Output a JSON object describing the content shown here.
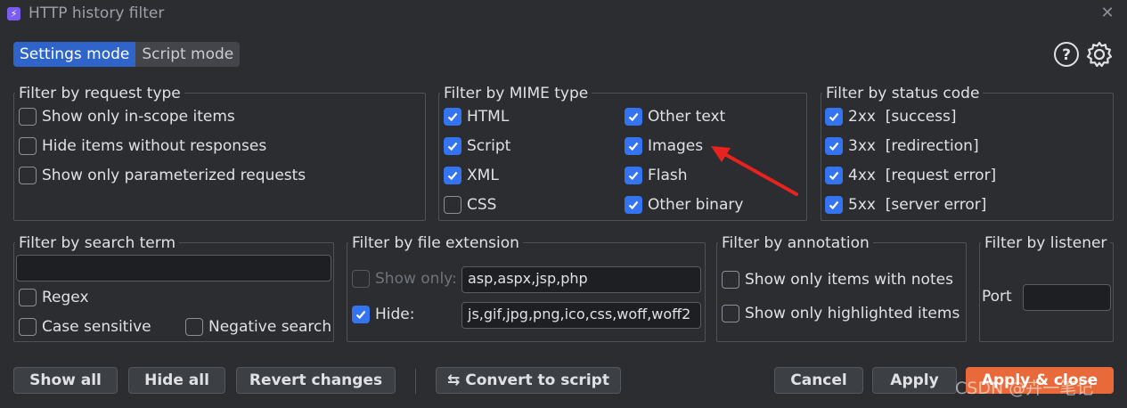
{
  "window": {
    "title": "HTTP history filter",
    "app_icon_glyph": "⚡"
  },
  "mode": {
    "settings_label": "Settings mode",
    "script_label": "Script mode",
    "active": "settings"
  },
  "request_type": {
    "legend": "Filter by request type",
    "items": [
      {
        "label": "Show only in-scope items",
        "checked": false
      },
      {
        "label": "Hide items without responses",
        "checked": false
      },
      {
        "label": "Show only parameterized requests",
        "checked": false
      }
    ]
  },
  "mime_type": {
    "legend": "Filter by MIME type",
    "items": [
      {
        "label": "HTML",
        "checked": true
      },
      {
        "label": "Other text",
        "checked": true
      },
      {
        "label": "Script",
        "checked": true
      },
      {
        "label": "Images",
        "checked": true
      },
      {
        "label": "XML",
        "checked": true
      },
      {
        "label": "Flash",
        "checked": true
      },
      {
        "label": "CSS",
        "checked": false
      },
      {
        "label": "Other binary",
        "checked": true
      }
    ]
  },
  "status_code": {
    "legend": "Filter by status code",
    "items": [
      {
        "label": "2xx  [success]",
        "checked": true
      },
      {
        "label": "3xx  [redirection]",
        "checked": true
      },
      {
        "label": "4xx  [request error]",
        "checked": true
      },
      {
        "label": "5xx  [server error]",
        "checked": true
      }
    ]
  },
  "search_term": {
    "legend": "Filter by search term",
    "value": "",
    "regex": "Regex",
    "case_sensitive": "Case sensitive",
    "negative": "Negative search"
  },
  "file_extension": {
    "legend": "Filter by file extension",
    "show_only_label": "Show only:",
    "show_only_value": "asp,aspx,jsp,php",
    "hide_label": "Hide:",
    "hide_value": "js,gif,jpg,png,ico,css,woff,woff2"
  },
  "annotation": {
    "legend": "Filter by annotation",
    "notes": "Show only items with notes",
    "highlighted": "Show only highlighted items"
  },
  "listener": {
    "legend": "Filter by listener",
    "port_label": "Port",
    "port_value": ""
  },
  "buttons": {
    "show_all": "Show all",
    "hide_all": "Hide all",
    "revert": "Revert changes",
    "convert": "Convert to script",
    "convert_icon": "⇆",
    "cancel": "Cancel",
    "apply": "Apply",
    "apply_close": "Apply & close"
  },
  "watermark": "CSDN @卉一笔记",
  "colors": {
    "accent": "#3574f0",
    "primary_button": "#e86a3a",
    "annotation_arrow": "#e8231f"
  }
}
